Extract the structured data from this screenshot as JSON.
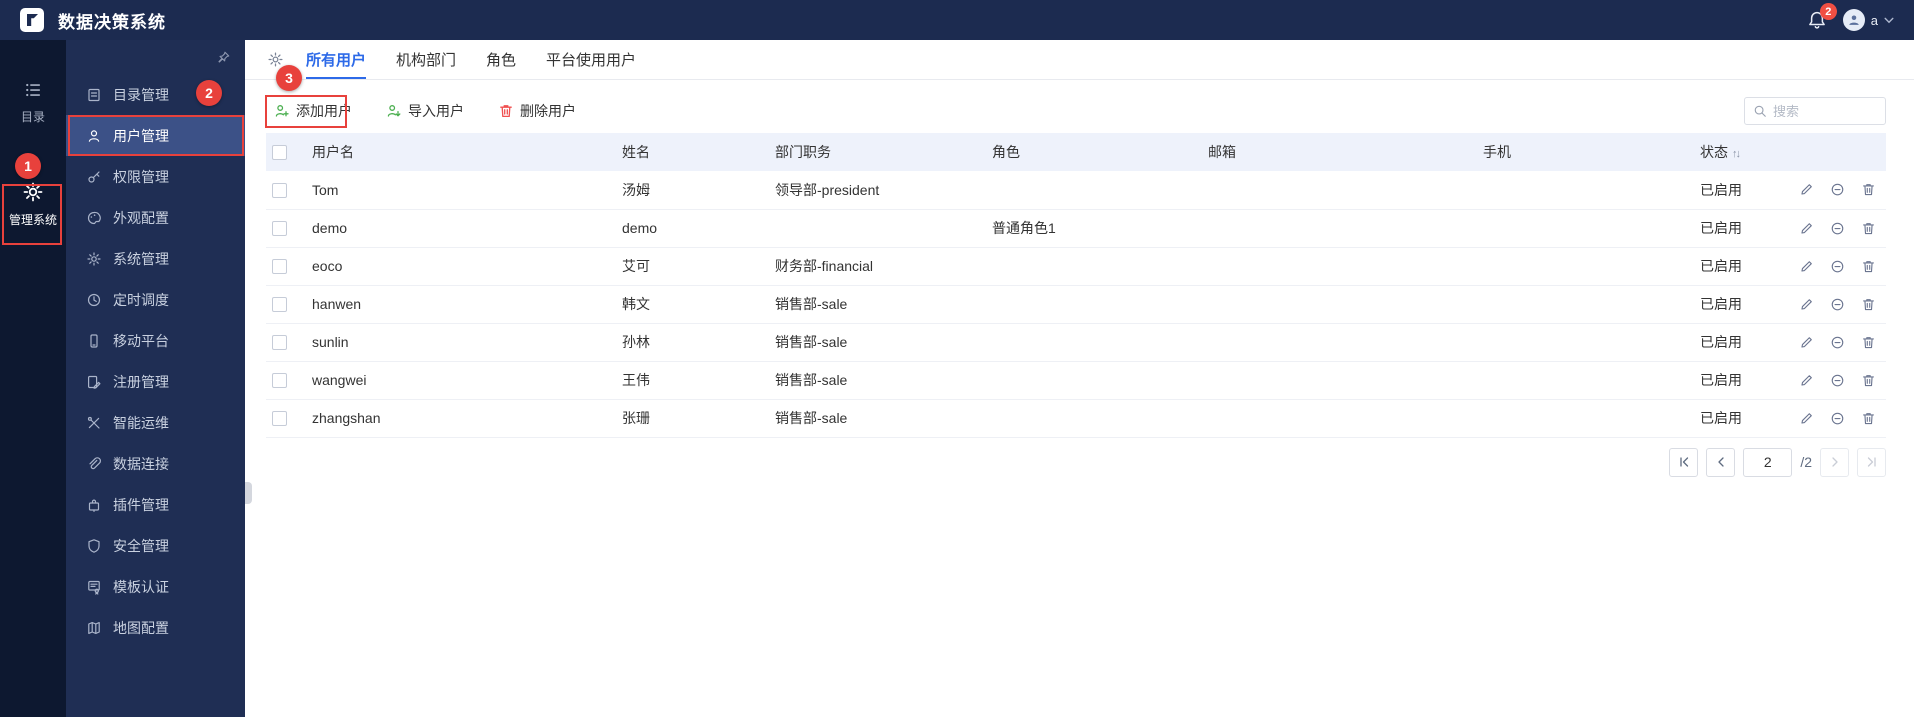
{
  "topbar": {
    "title": "数据决策系统",
    "notification_badge": "2",
    "user_name": "a"
  },
  "rail": {
    "items": [
      {
        "label": "目录"
      },
      {
        "label": "管理系统"
      }
    ]
  },
  "sidebar": {
    "items": [
      {
        "label": "目录管理"
      },
      {
        "label": "用户管理"
      },
      {
        "label": "权限管理"
      },
      {
        "label": "外观配置"
      },
      {
        "label": "系统管理"
      },
      {
        "label": "定时调度"
      },
      {
        "label": "移动平台"
      },
      {
        "label": "注册管理"
      },
      {
        "label": "智能运维"
      },
      {
        "label": "数据连接"
      },
      {
        "label": "插件管理"
      },
      {
        "label": "安全管理"
      },
      {
        "label": "模板认证"
      },
      {
        "label": "地图配置"
      }
    ]
  },
  "tabs": {
    "items": [
      {
        "label": "所有用户"
      },
      {
        "label": "机构部门"
      },
      {
        "label": "角色"
      },
      {
        "label": "平台使用用户"
      }
    ]
  },
  "toolbar": {
    "add_user": "添加用户",
    "import_user": "导入用户",
    "delete_user": "删除用户",
    "search_placeholder": "搜索"
  },
  "table": {
    "headers": {
      "username": "用户名",
      "name": "姓名",
      "department": "部门职务",
      "role": "角色",
      "email": "邮箱",
      "phone": "手机",
      "status": "状态"
    },
    "rows": [
      {
        "username": "Tom",
        "name": "汤姆",
        "department": "领导部-president",
        "role": "",
        "email": "",
        "phone": "",
        "status": "已启用"
      },
      {
        "username": "demo",
        "name": "demo",
        "department": "",
        "role": "普通角色1",
        "email": "",
        "phone": "",
        "status": "已启用"
      },
      {
        "username": "eoco",
        "name": "艾可",
        "department": "财务部-financial",
        "role": "",
        "email": "",
        "phone": "",
        "status": "已启用"
      },
      {
        "username": "hanwen",
        "name": "韩文",
        "department": "销售部-sale",
        "role": "",
        "email": "",
        "phone": "",
        "status": "已启用"
      },
      {
        "username": "sunlin",
        "name": "孙林",
        "department": "销售部-sale",
        "role": "",
        "email": "",
        "phone": "",
        "status": "已启用"
      },
      {
        "username": "wangwei",
        "name": "王伟",
        "department": "销售部-sale",
        "role": "",
        "email": "",
        "phone": "",
        "status": "已启用"
      },
      {
        "username": "zhangshan",
        "name": "张珊",
        "department": "销售部-sale",
        "role": "",
        "email": "",
        "phone": "",
        "status": "已启用"
      }
    ]
  },
  "pagination": {
    "current_page": "2",
    "total": "/2"
  },
  "annotations": {
    "step1": "1",
    "step2": "2",
    "step3": "3"
  }
}
